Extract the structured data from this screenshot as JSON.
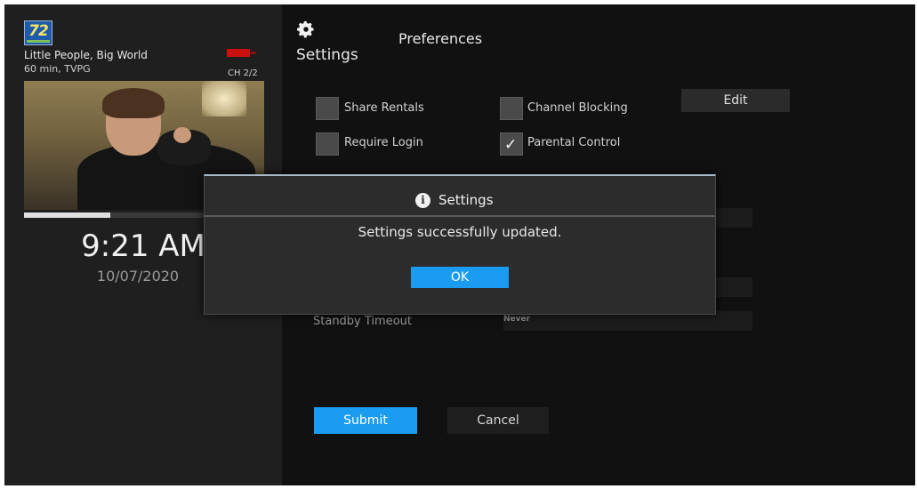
{
  "now_playing": {
    "channel_logo_text": "72",
    "show_title": "Little People, Big World",
    "show_meta": "60 min, TVPG",
    "channel_count": "CH 2/2",
    "progress": 0.36
  },
  "clock": {
    "time": "9:21 AM",
    "date": "10/07/2020"
  },
  "header": {
    "settings_label": "Settings",
    "section_title": "Preferences",
    "settings_icon": "gear-icon"
  },
  "preferences": {
    "share_rentals": {
      "label": "Share Rentals",
      "checked": false
    },
    "channel_blocking": {
      "label": "Channel Blocking",
      "checked": false
    },
    "require_login": {
      "label": "Require Login",
      "checked": false
    },
    "parental_control": {
      "label": "Parental Control",
      "checked": true
    },
    "edit_label": "Edit",
    "standby_label": "Standby Timeout",
    "standby_value": "Never"
  },
  "actions": {
    "submit_label": "Submit",
    "cancel_label": "Cancel"
  },
  "dialog": {
    "icon": "info-icon",
    "title": "Settings",
    "message": "Settings successfully updated.",
    "ok_label": "OK"
  },
  "colors": {
    "accent": "#1a9cf0",
    "background": "#121212",
    "panel": "#1f1f1f",
    "dialog": "#2c2c2c"
  }
}
